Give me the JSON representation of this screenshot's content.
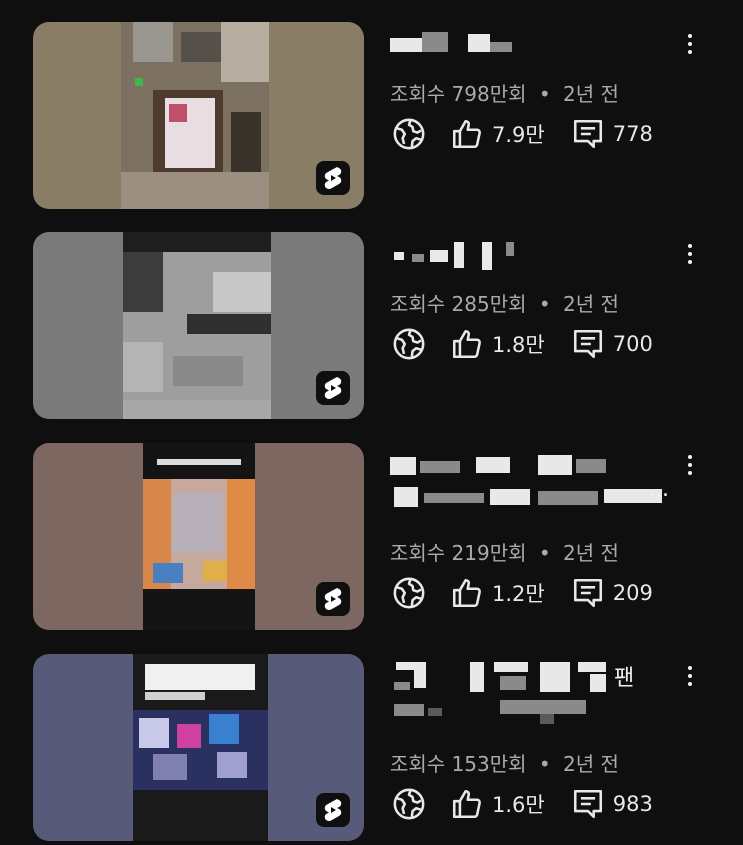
{
  "videos": [
    {
      "title_suffix": "",
      "views": "조회수 798만회",
      "age": "2년 전",
      "likes": "7.9만",
      "comments": "778",
      "thumb_bg": "#8a7d66"
    },
    {
      "title_suffix": "",
      "views": "조회수 285만회",
      "age": "2년 전",
      "likes": "1.8만",
      "comments": "700",
      "thumb_bg": "#7a7a7a"
    },
    {
      "title_suffix": "...",
      "views": "조회수 219만회",
      "age": "2년 전",
      "likes": "1.2만",
      "comments": "209",
      "thumb_bg": "#7c6860"
    },
    {
      "title_suffix": "팬",
      "views": "조회수 153만회",
      "age": "2년 전",
      "likes": "1.6만",
      "comments": "983",
      "thumb_bg": "#575a78"
    }
  ],
  "separator": "•",
  "icons": {
    "globe": "globe-icon",
    "like": "thumbs-up-icon",
    "comment": "comment-icon",
    "more": "more-vert-icon",
    "shorts": "shorts-icon"
  }
}
